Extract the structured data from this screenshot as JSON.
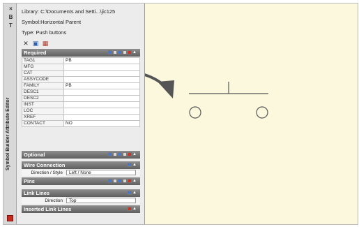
{
  "window": {
    "vertical_title": "Symbol Builder Attribute Editor",
    "strip_buttons": [
      "×",
      "B",
      "T"
    ]
  },
  "palette": {
    "library": "Library: C:\\Documents and Setti...\\jic125",
    "symbol": "Symbol:Horizontal Parent",
    "type": "Type:  Push buttons",
    "sections": {
      "required": {
        "title": "Required",
        "rows": [
          {
            "key": "TAG1",
            "value": "PB"
          },
          {
            "key": "MFG",
            "value": ""
          },
          {
            "key": "CAT",
            "value": ""
          },
          {
            "key": "ASSYCODE",
            "value": ""
          },
          {
            "key": "FAMILY",
            "value": "PB"
          },
          {
            "key": "DESC1",
            "value": ""
          },
          {
            "key": "DESC2",
            "value": ""
          },
          {
            "key": "INST",
            "value": ""
          },
          {
            "key": "LOC",
            "value": ""
          },
          {
            "key": "XREF",
            "value": ""
          },
          {
            "key": "CONTACT",
            "value": "NO"
          }
        ]
      },
      "optional": {
        "title": "Optional"
      },
      "wire_connection": {
        "title": "Wire Connection",
        "label": "Direction / Style",
        "value": "Left / None"
      },
      "pins": {
        "title": "Pins"
      },
      "link_lines": {
        "title": "Link Lines",
        "label": "Direction",
        "value": "Top"
      },
      "inserted_link_lines": {
        "title": "Inserted Link Lines"
      }
    }
  },
  "colors": {
    "canvas_bg": "#fbf8de",
    "header_bg": "#6e6e6e",
    "arrow": "#555555"
  }
}
